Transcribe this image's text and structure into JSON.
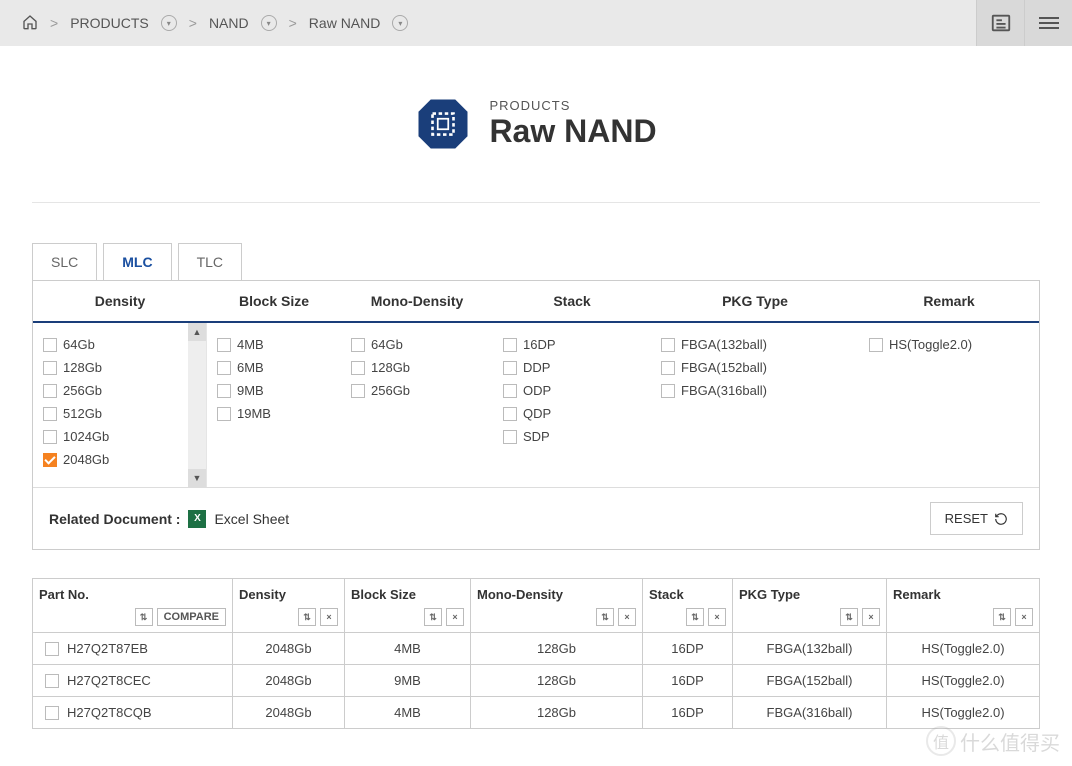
{
  "breadcrumb": {
    "home": "⌂",
    "l1": "PRODUCTS",
    "l2": "NAND",
    "l3": "Raw NAND"
  },
  "hero": {
    "sub": "PRODUCTS",
    "title": "Raw NAND"
  },
  "tabs": {
    "slc": "SLC",
    "mlc": "MLC",
    "tlc": "TLC"
  },
  "filters": {
    "headers": {
      "density": "Density",
      "block": "Block Size",
      "mono": "Mono-Density",
      "stack": "Stack",
      "pkg": "PKG Type",
      "remark": "Remark"
    },
    "density": [
      {
        "label": "64Gb",
        "checked": false
      },
      {
        "label": "128Gb",
        "checked": false
      },
      {
        "label": "256Gb",
        "checked": false
      },
      {
        "label": "512Gb",
        "checked": false
      },
      {
        "label": "1024Gb",
        "checked": false
      },
      {
        "label": "2048Gb",
        "checked": true
      }
    ],
    "block": [
      {
        "label": "4MB",
        "checked": false
      },
      {
        "label": "6MB",
        "checked": false
      },
      {
        "label": "9MB",
        "checked": false
      },
      {
        "label": "19MB",
        "checked": false
      }
    ],
    "mono": [
      {
        "label": "64Gb",
        "checked": false
      },
      {
        "label": "128Gb",
        "checked": false
      },
      {
        "label": "256Gb",
        "checked": false
      }
    ],
    "stack": [
      {
        "label": "16DP",
        "checked": false
      },
      {
        "label": "DDP",
        "checked": false
      },
      {
        "label": "ODP",
        "checked": false
      },
      {
        "label": "QDP",
        "checked": false
      },
      {
        "label": "SDP",
        "checked": false
      }
    ],
    "pkg": [
      {
        "label": "FBGA(132ball)",
        "checked": false
      },
      {
        "label": "FBGA(152ball)",
        "checked": false
      },
      {
        "label": "FBGA(316ball)",
        "checked": false
      }
    ],
    "remark": [
      {
        "label": "HS(Toggle2.0)",
        "checked": false
      }
    ]
  },
  "related": {
    "label": "Related Document :",
    "link": "Excel Sheet",
    "reset": "RESET"
  },
  "table": {
    "headers": {
      "part": "Part No.",
      "density": "Density",
      "block": "Block Size",
      "mono": "Mono-Density",
      "stack": "Stack",
      "pkg": "PKG Type",
      "remark": "Remark",
      "compare": "COMPARE"
    },
    "rows": [
      {
        "part": "H27Q2T87EB",
        "density": "2048Gb",
        "block": "4MB",
        "mono": "128Gb",
        "stack": "16DP",
        "pkg": "FBGA(132ball)",
        "remark": "HS(Toggle2.0)"
      },
      {
        "part": "H27Q2T8CEC",
        "density": "2048Gb",
        "block": "9MB",
        "mono": "128Gb",
        "stack": "16DP",
        "pkg": "FBGA(152ball)",
        "remark": "HS(Toggle2.0)"
      },
      {
        "part": "H27Q2T8CQB",
        "density": "2048Gb",
        "block": "4MB",
        "mono": "128Gb",
        "stack": "16DP",
        "pkg": "FBGA(316ball)",
        "remark": "HS(Toggle2.0)"
      }
    ]
  },
  "watermark": {
    "badge": "值",
    "text": "什么值得买"
  }
}
